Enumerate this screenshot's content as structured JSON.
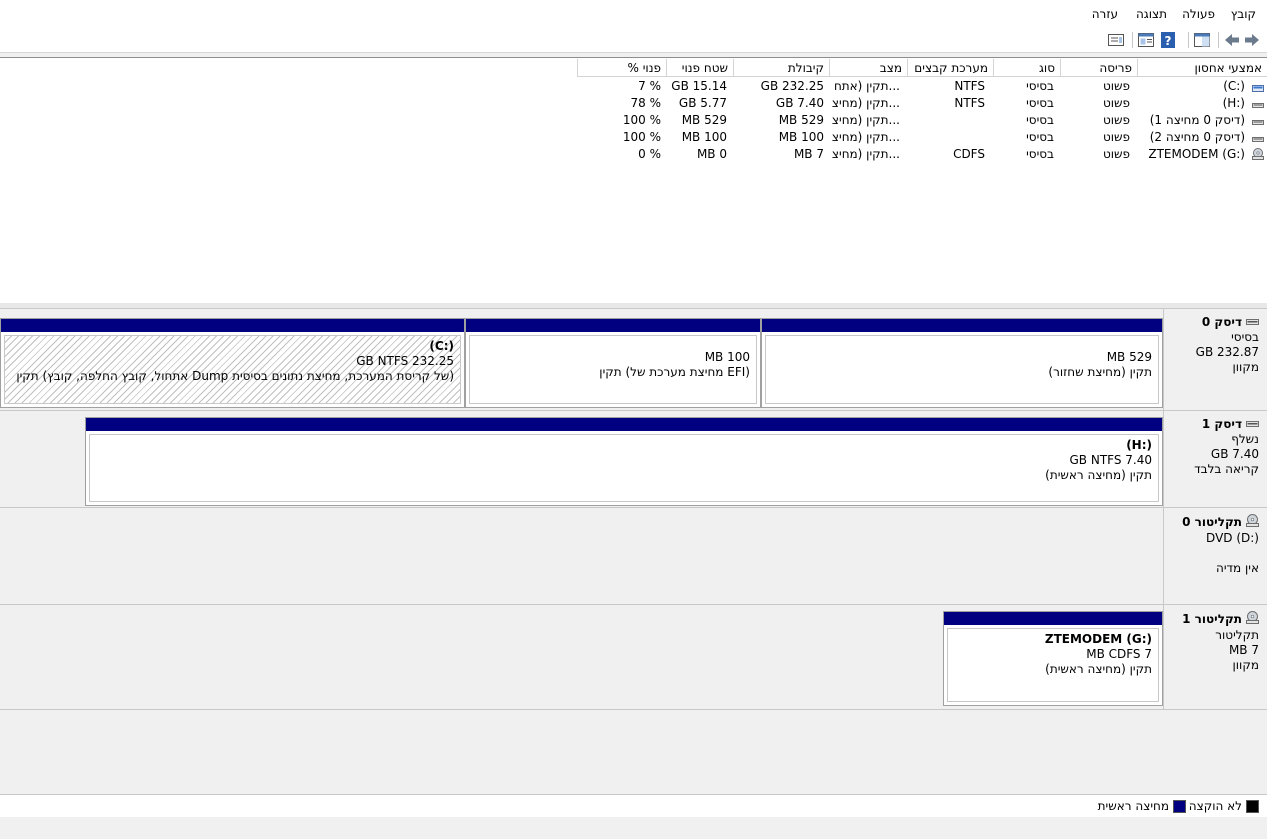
{
  "menu": {
    "file": "קובץ",
    "action": "פעולה",
    "view": "תצוגה",
    "help": "עזרה"
  },
  "toolbar": {
    "icons": [
      "back-arrow-icon",
      "forward-arrow-icon",
      "console-tree-icon",
      "help-icon",
      "properties-icon",
      "view-icon"
    ]
  },
  "volume_list": {
    "columns": [
      "אמצעי אחסון",
      "פריסה",
      "סוג",
      "מערכת קבצים",
      "מצב",
      "קיבולת",
      "שטח פנוי",
      "% פנוי"
    ],
    "rows": [
      {
        "icon": "volume-c-icon",
        "volume": "(C:)",
        "layout": "פשוט",
        "type": "בסיסי",
        "filesystem": "NTFS",
        "status": "תקין (אתח...",
        "capacity": "GB 232.25",
        "free": "GB 15.14",
        "percent_free": "7 %"
      },
      {
        "icon": "volume-icon",
        "volume": "(H:)",
        "layout": "פשוט",
        "type": "בסיסי",
        "filesystem": "NTFS",
        "status": "תקין (מחיצ...",
        "capacity": "GB 7.40",
        "free": "GB 5.77",
        "percent_free": "78 %"
      },
      {
        "icon": "volume-icon",
        "volume": "(דיסק 0 מחיצה 1)",
        "layout": "פשוט",
        "type": "בסיסי",
        "filesystem": "",
        "status": "תקין (מחיצ...",
        "capacity": "MB 529",
        "free": "MB 529",
        "percent_free": "100 %"
      },
      {
        "icon": "volume-icon",
        "volume": "(דיסק 0 מחיצה 2)",
        "layout": "פשוט",
        "type": "בסיסי",
        "filesystem": "",
        "status": "תקין (מחיצ...",
        "capacity": "MB 100",
        "free": "MB 100",
        "percent_free": "100 %"
      },
      {
        "icon": "cd-drive-icon",
        "volume": "ZTEMODEM (G:)",
        "layout": "פשוט",
        "type": "בסיסי",
        "filesystem": "CDFS",
        "status": "תקין (מחיצ...",
        "capacity": "MB 7",
        "free": "MB 0",
        "percent_free": "0 %"
      }
    ]
  },
  "disks": {
    "disk0": {
      "name": "דיסק 0",
      "type": "בסיסי",
      "size": "GB 232.87",
      "state": "מקוון",
      "partitions": [
        {
          "line1": "MB 529",
          "line2": "תקין (מחיצת שחזור)"
        },
        {
          "line1": "MB 100",
          "line2": "תקין (מחיצת מערכת של EFI)"
        },
        {
          "title": "(C:)",
          "line1": "GB NTFS 232.25",
          "line2": "תקין (אתחול, קובץ החלפה, קובץ Dump של קריסת המערכת, מחיצת נתונים בסיסית)"
        }
      ]
    },
    "disk1": {
      "name": "דיסק 1",
      "type": "נשלף",
      "size": "GB 7.40",
      "state": "קריאה בלבד",
      "partition": {
        "title": "(H:)",
        "line1": "GB NTFS 7.40",
        "line2": "תקין (מחיצה ראשית)"
      }
    },
    "cdrom0": {
      "name": "תקליטור 0",
      "type": "DVD (D:)",
      "state": "אין מדיה"
    },
    "cdrom1": {
      "name": "תקליטור 1",
      "type": "תקליטור",
      "size": "MB 7",
      "state": "מקוון",
      "partition": {
        "title": "ZTEMODEM  (G:)",
        "line1": "MB CDFS 7",
        "line2": "תקין (מחיצה ראשית)"
      }
    }
  },
  "legend": {
    "unallocated": "לא הוקצה",
    "primary": "מחיצה ראשית"
  },
  "colors": {
    "primary_partition": "#000080",
    "unallocated": "#000000"
  }
}
